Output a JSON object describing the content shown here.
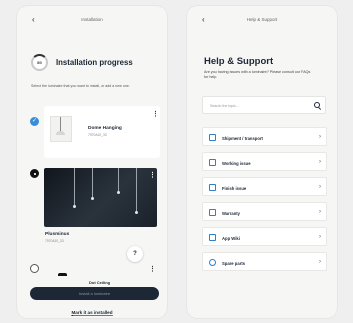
{
  "left": {
    "back_icon": "chevron-left-icon",
    "title": "Installation",
    "progress": {
      "ring_label": "8/0",
      "title": "Installation progress",
      "description": "Select the luminaire that you want to install, or add a new one."
    },
    "items": [
      {
        "name": "Dome Hanging",
        "code": "7970A10_33",
        "state": "checked"
      },
      {
        "name": "Plusminus",
        "code": "7970A10_33",
        "state": "selected"
      },
      {
        "name": "Dot Ceiling",
        "code": "",
        "state": "unchecked"
      }
    ],
    "help_label": "?",
    "primary_button": "Install a luminaire",
    "link": "Mark it as installed"
  },
  "right": {
    "back_icon": "chevron-left-icon",
    "title": "Help & Support",
    "heading": "Help & Support",
    "subheading": "Are you having issues with a luminaire? Please consult our FAQs for help.",
    "search": {
      "placeholder": "Search the topic...",
      "icon": "search-icon"
    },
    "topics": [
      {
        "label": "Shipment / transport",
        "icon": "box-icon"
      },
      {
        "label": "Working issue",
        "icon": "wrench-icon"
      },
      {
        "label": "Finish issue",
        "icon": "brush-icon"
      },
      {
        "label": "Warranty",
        "icon": "shield-icon"
      },
      {
        "label": "App Wiki",
        "icon": "book-icon"
      },
      {
        "label": "Spare parts",
        "icon": "gear-icon"
      }
    ],
    "accent": "#2f80c6"
  }
}
